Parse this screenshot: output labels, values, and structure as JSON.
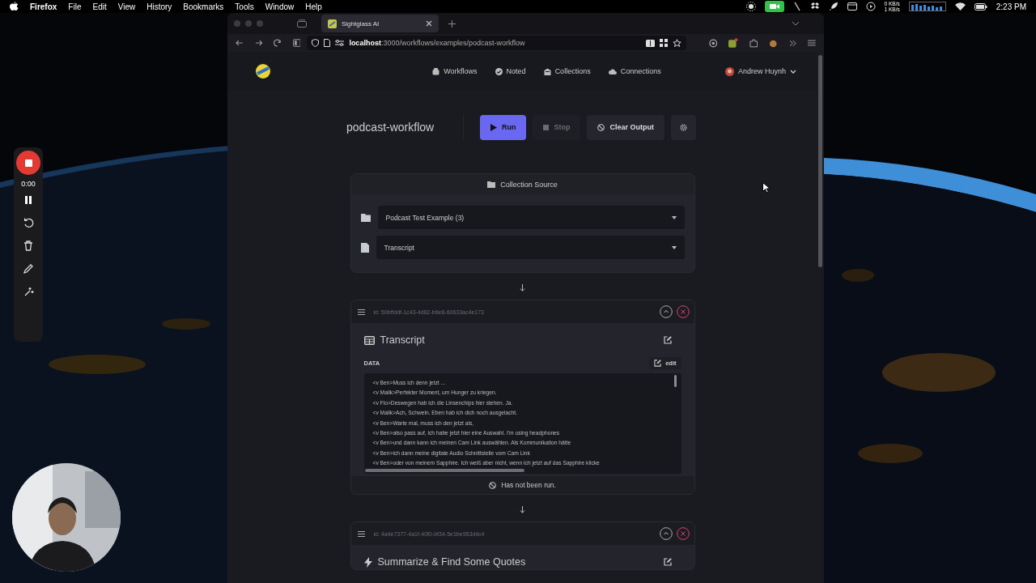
{
  "menubar": {
    "app": "Firefox",
    "menus": [
      "File",
      "Edit",
      "View",
      "History",
      "Bookmarks",
      "Tools",
      "Window",
      "Help"
    ],
    "net_up": "0 KB/s",
    "net_down": "1 KB/s",
    "clock": "2:23 PM"
  },
  "recorder": {
    "time": "0:00"
  },
  "browser": {
    "tabs": [
      {
        "label": "Sightglass AI",
        "selected": true
      }
    ],
    "url_host": "localhost",
    "url_path": ":3000/workflows/examples/podcast-workflow"
  },
  "nav": {
    "items": [
      {
        "label": "Workflows",
        "kind": "robot"
      },
      {
        "label": "Noted",
        "kind": "check"
      },
      {
        "label": "Collections",
        "kind": "building"
      },
      {
        "label": "Connections",
        "kind": "cloud"
      }
    ],
    "user": "Andrew Huynh"
  },
  "workflow": {
    "title": "podcast-workflow",
    "buttons": [
      {
        "label": "Run",
        "kind": "run",
        "disabled": false
      },
      {
        "label": "Stop",
        "kind": "stop",
        "disabled": true
      },
      {
        "label": "Clear Output",
        "kind": "clear",
        "disabled": false
      }
    ],
    "source": {
      "title": "Collection Source",
      "collection": "Podcast Test Example (3)",
      "document": "Transcript"
    },
    "steps": [
      {
        "kind": "data",
        "id": "id: 50bffddf-1c43-4d82-b6e8-60633ac4e173",
        "title": "Transcript",
        "data_label": "DATA",
        "edit": "edit",
        "lines": [
          "<v Ben>Muss ich denn jetzt ...",
          "<v Malik>Perfekter Moment, um Hunger zu kriegen.",
          "<v Flo>Deswegen hab ich die Linsenchips hier stehen. Ja.",
          "<v Malik>Ach, Schwein. Eben hab ich dich noch ausgelacht.",
          "<v Ben>Warte mal, muss ich den jetzt als,",
          "<v Ben>also pass auf, ich habe jetzt hier eine Auswahl. I'm using headphones",
          "<v Ben>und dann kann ich meinen Cam Link auswählen. Als Kommunikation hätte",
          "<v Ben>ich dann meine digitale Audio Schnittstelle vom Cam Link",
          "<v Ben>oder von meinem Sapphire. Ich weiß aber nicht, wenn ich jetzt auf das Sapphire klicke"
        ],
        "status": "Has not been run."
      },
      {
        "kind": "action",
        "id": "id: 4a4e7377-4a1f-40f0-bf34-5e1be953d4c4",
        "title": "Summarize & Find Some Quotes"
      }
    ]
  }
}
